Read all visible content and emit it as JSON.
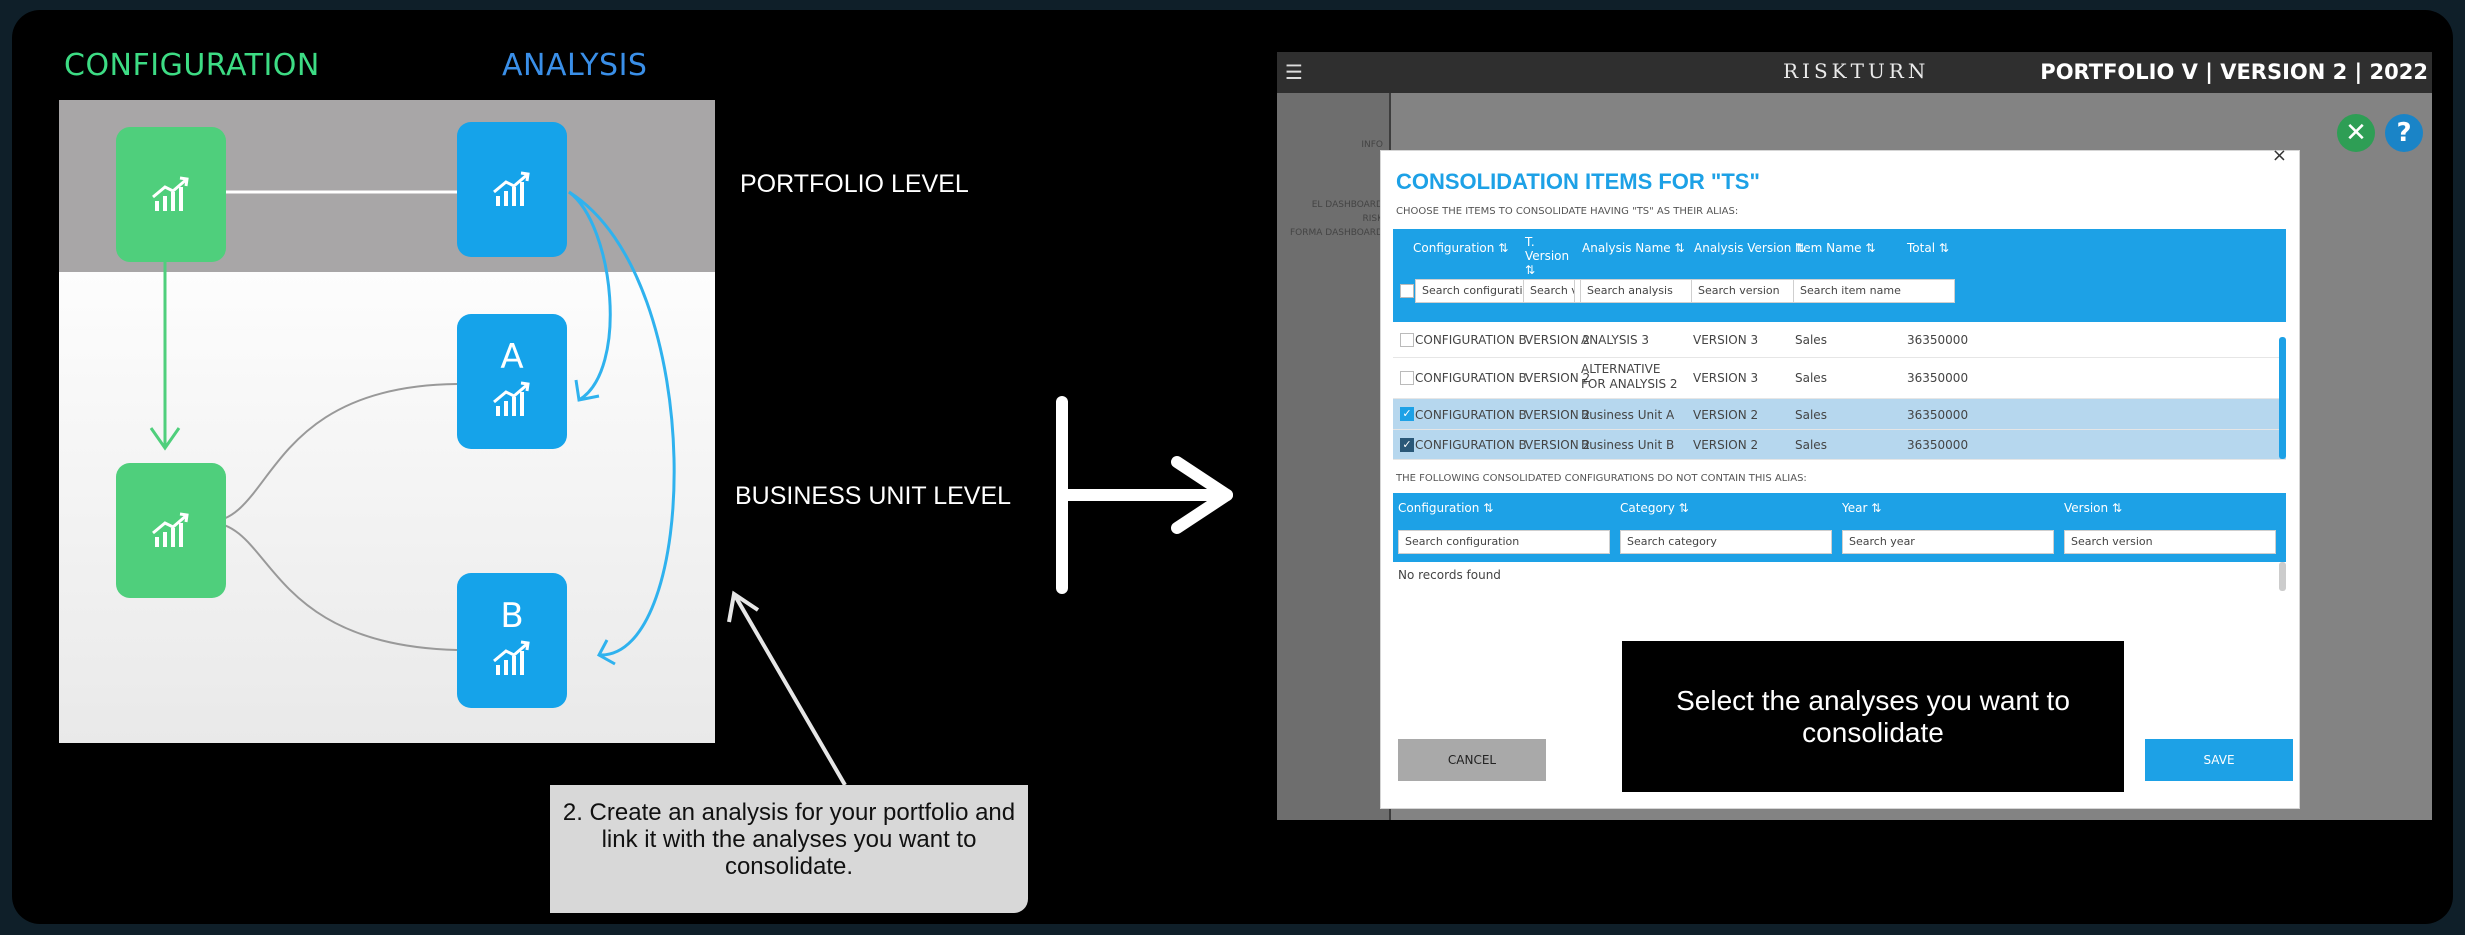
{
  "diagram": {
    "header_configuration": "CONFIGURATION",
    "header_analysis": "ANALYSIS",
    "tile_a_letter": "A",
    "tile_b_letter": "B",
    "portfolio_level": "PORTFOLIO LEVEL",
    "business_unit_level": "BUSINESS UNIT LEVEL",
    "callout": "2. Create an analysis for your portfolio and link it with the analyses you want to consolidate.",
    "colors": {
      "configuration": "#4fcf7c",
      "analysis": "#15a3ea"
    }
  },
  "app": {
    "brand": "RISKTURN",
    "version_title": "PORTFOLIO V | VERSION 2 | 2022",
    "sidebar_items": [
      "INFO",
      "EL DASHBOARD",
      "RISK",
      "FORMA DASHBOARD"
    ]
  },
  "modal": {
    "title": "CONSOLIDATION ITEMS FOR \"TS\"",
    "subtitle": "CHOOSE THE ITEMS TO CONSOLIDATE HAVING \"TS\" AS THEIR ALIAS:",
    "close": "×",
    "columns": [
      "Configuration ⇅",
      "T. Version ⇅",
      "Analysis Name ⇅",
      "Analysis Version ⇅",
      "Item Name ⇅",
      "Total ⇅"
    ],
    "filters": [
      "Search configuration",
      "Search ver",
      "Search analysis",
      "Search version",
      "Search item name"
    ],
    "rows": [
      {
        "configuration": "CONFIGURATION B",
        "t_version": "VERSION 2",
        "analysis_name": "ANALYSIS 3",
        "analysis_version": "VERSION 3",
        "item_name": "Sales",
        "total": "36350000",
        "checked": false
      },
      {
        "configuration": "CONFIGURATION B",
        "t_version": "VERSION 2",
        "analysis_name": "ALTERNATIVE FOR ANALYSIS 2",
        "analysis_version": "VERSION 3",
        "item_name": "Sales",
        "total": "36350000",
        "checked": false
      },
      {
        "configuration": "CONFIGURATION B",
        "t_version": "VERSION 2",
        "analysis_name": "Business Unit A",
        "analysis_version": "VERSION 2",
        "item_name": "Sales",
        "total": "36350000",
        "checked": true
      },
      {
        "configuration": "CONFIGURATION B",
        "t_version": "VERSION 2",
        "analysis_name": "Business Unit B",
        "analysis_version": "VERSION 2",
        "item_name": "Sales",
        "total": "36350000",
        "checked": true
      }
    ],
    "second_subtitle": "THE FOLLOWING CONSOLIDATED CONFIGURATIONS DO NOT CONTAIN THIS ALIAS:",
    "columns2": [
      "Configuration ⇅",
      "Category ⇅",
      "Year ⇅",
      "Version ⇅"
    ],
    "filters2": [
      "Search configuration",
      "Search category",
      "Search year",
      "Search version"
    ],
    "empty": "No records found",
    "cancel": "CANCEL",
    "save": "SAVE"
  },
  "caption": "Select the analyses you want to consolidate"
}
